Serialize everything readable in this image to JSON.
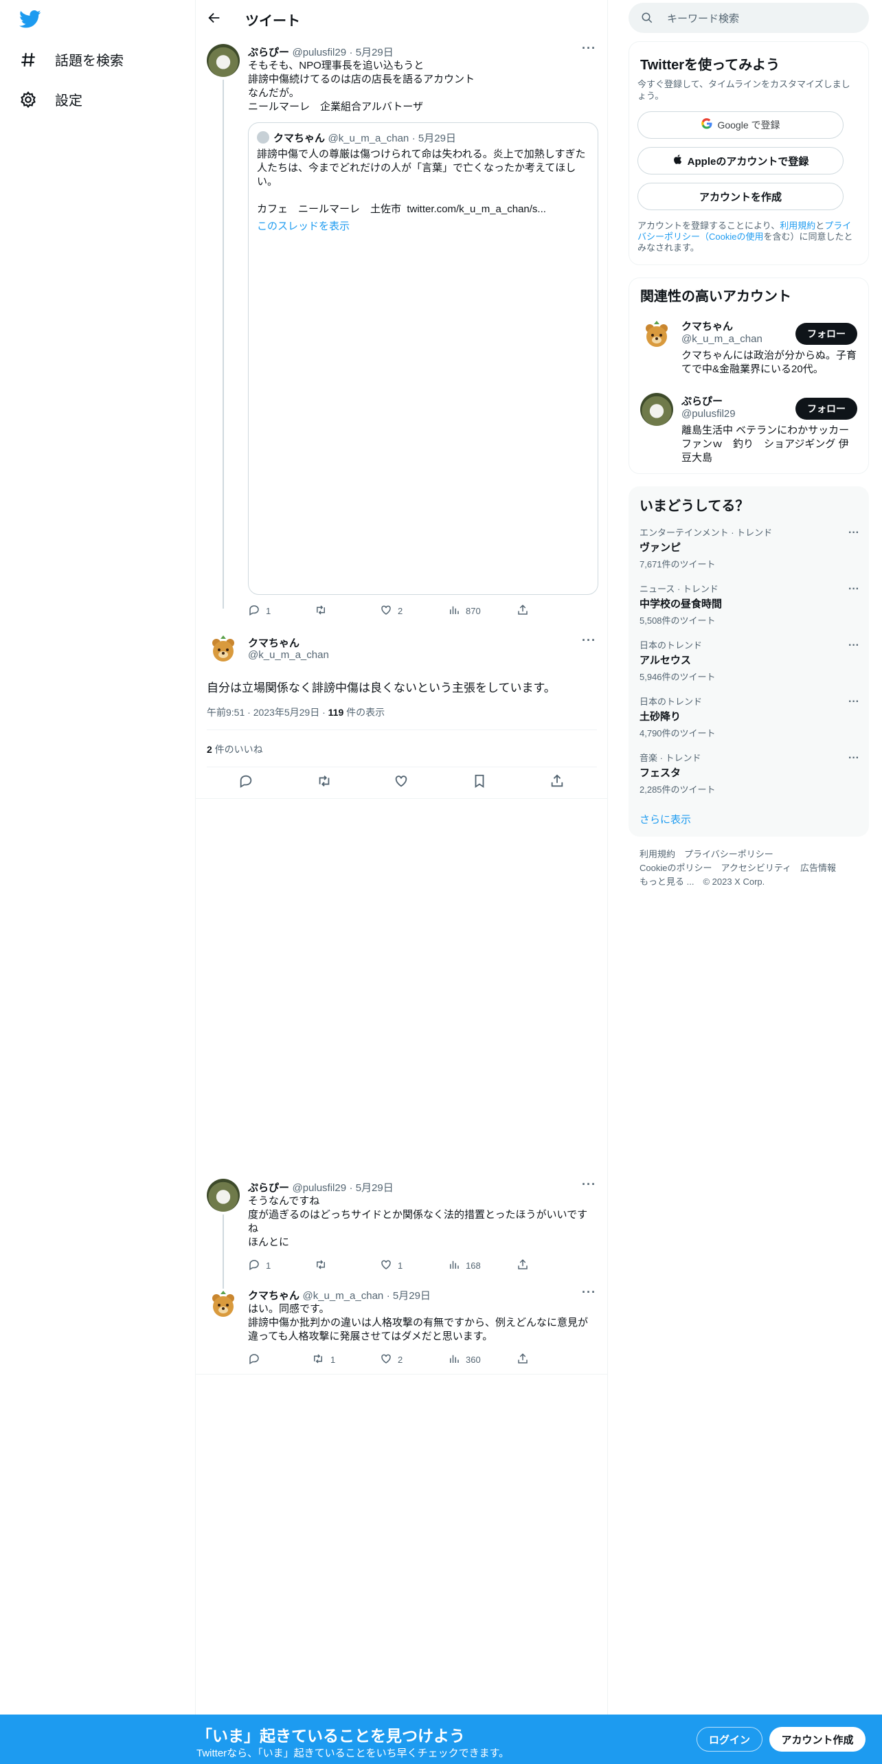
{
  "nav": {
    "items": [
      {
        "label": "話題を検索",
        "icon": "hashtag-icon"
      },
      {
        "label": "設定",
        "icon": "gear-icon"
      }
    ]
  },
  "header": {
    "title": "ツイート"
  },
  "tweet1": {
    "name": "ぷらぴー",
    "handle": "@pulusfil29",
    "date": "· 5月29日",
    "text": "そもそも、NPO理事長を追い込もうと\n誹謗中傷続けてるのは店の店長を語るアカウント\nなんだが。\nニールマーレ　企業組合アルバトーザ",
    "quote": {
      "name": "クマちゃん",
      "handle": "@k_u_m_a_chan",
      "date": "· 5月29日",
      "text": "誹謗中傷で人の尊厳は傷つけられて命は失われる。炎上で加熱しすぎた人たちは、今までどれだけの人が「言葉」で亡くなったか考えてほしい。\n\nカフェ　ニールマーレ　土佐市  twitter.com/k_u_m_a_chan/s...",
      "thread_link": "このスレッドを表示"
    },
    "replies": "1",
    "retweets": "",
    "likes": "2",
    "views": "870"
  },
  "main_tweet": {
    "name": "クマちゃん",
    "handle": "@k_u_m_a_chan",
    "text": "自分は立場関係なく誹謗中傷は良くないという主張をしています。",
    "time": "午前9:51 · 2023年5月29日 · ",
    "views_count": "119",
    "views_label": " 件の表示",
    "likes_count": "2",
    "likes_label": " 件のいいね"
  },
  "tweet3": {
    "name": "ぷらぴー",
    "handle": "@pulusfil29",
    "date": "· 5月29日",
    "text": "そうなんですね\n度が過ぎるのはどっちサイドとか関係なく法的措置とったほうがいいですね\nほんとに",
    "replies": "1",
    "retweets": "",
    "likes": "1",
    "views": "168"
  },
  "tweet4": {
    "name": "クマちゃん",
    "handle": "@k_u_m_a_chan",
    "date": "· 5月29日",
    "text": "はい。同感です。\n誹謗中傷か批判かの違いは人格攻撃の有無ですから、例えどんなに意見が違っても人格攻撃に発展させてはダメだと思います。",
    "replies": "",
    "retweets": "1",
    "likes": "2",
    "views": "360"
  },
  "search": {
    "placeholder": "キーワード検索"
  },
  "signup": {
    "title": "Twitterを使ってみよう",
    "subtitle": "今すぐ登録して、タイムラインをカスタマイズしましょう。",
    "google": "Google で登録",
    "apple": "Appleのアカウントで登録",
    "create": "アカウントを作成",
    "terms_pre": "アカウントを登録することにより、",
    "terms_link1": "利用規約",
    "terms_mid": "と",
    "terms_link2": "プライバシーポリシー（Cookieの使用",
    "terms_post": "を含む）に同意したとみなされます。"
  },
  "related": {
    "title": "関連性の高いアカウント",
    "follow_label": "フォロー",
    "accounts": [
      {
        "name": "クマちゃん",
        "handle": "@k_u_m_a_chan",
        "bio": "クマちゃんには政治が分からぬ。子育てで中&金融業界にいる20代。"
      },
      {
        "name": "ぷらぴー",
        "handle": "@pulusfil29",
        "bio": "離島生活中 ベテランにわかサッカーファンｗ　釣り　ショアジギング 伊豆大島"
      }
    ]
  },
  "trends": {
    "title": "いまどうしてる？",
    "items": [
      {
        "category": "エンターテインメント · トレンド",
        "name": "ヴァンピ",
        "count": "7,671件のツイート"
      },
      {
        "category": "ニュース · トレンド",
        "name": "中学校の昼食時間",
        "count": "5,508件のツイート"
      },
      {
        "category": "日本のトレンド",
        "name": "アルセウス",
        "count": "5,946件のツイート"
      },
      {
        "category": "日本のトレンド",
        "name": "土砂降り",
        "count": "4,790件のツイート"
      },
      {
        "category": "音楽 · トレンド",
        "name": "フェスタ",
        "count": "2,285件のツイート"
      }
    ],
    "show_more": "さらに表示"
  },
  "footer": {
    "line1": "利用規約　プライバシーポリシー",
    "line2": "Cookieのポリシー　アクセシビリティ　広告情報",
    "line3": "もっと見る ...　© 2023 X Corp."
  },
  "bottom": {
    "title": "「いま」起きていることを見つけよう",
    "subtitle": "Twitterなら、「いま」起きていることをいち早くチェックできます。",
    "login": "ログイン",
    "signup": "アカウント作成"
  },
  "colors": {
    "accent": "#1d9bf0",
    "text": "#0f1419",
    "muted": "#536471"
  }
}
